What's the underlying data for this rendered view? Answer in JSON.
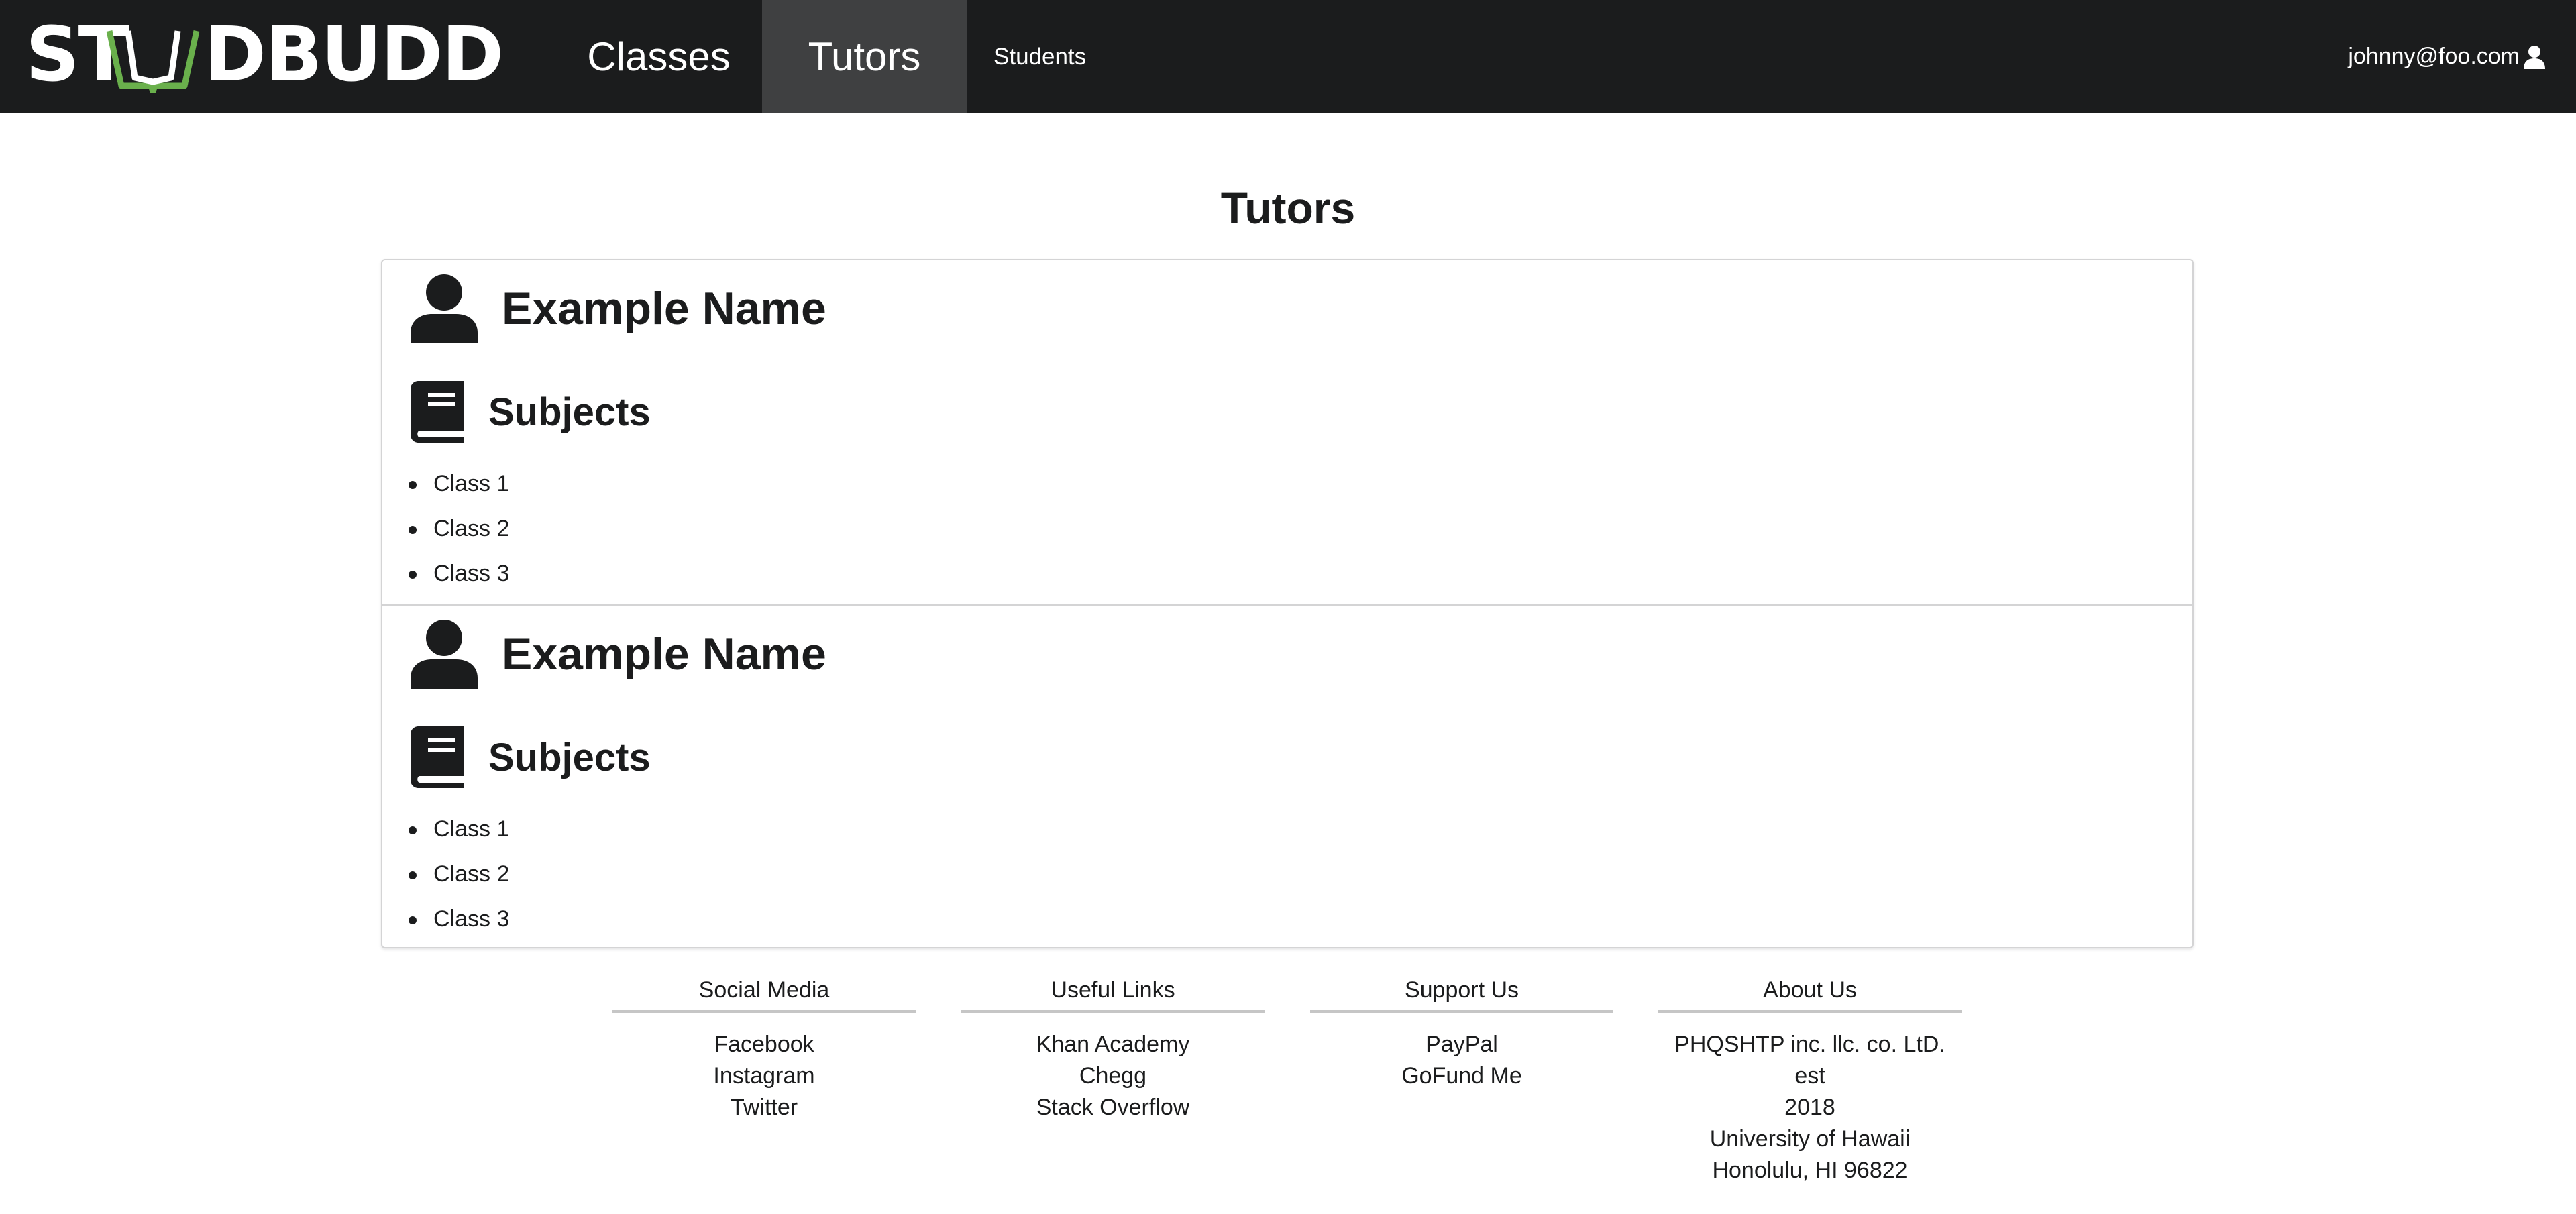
{
  "nav": {
    "logo_text_left": "ST",
    "logo_text_right": "DBUDD",
    "items": [
      {
        "label": "Classes",
        "active": false
      },
      {
        "label": "Tutors",
        "active": true
      },
      {
        "label": "Students",
        "active": false
      }
    ],
    "user_email": "johnny@foo.com",
    "user_icon": "user-icon"
  },
  "colors": {
    "navbar": "#1b1c1d",
    "active_tab": "#3f4041",
    "logo_accent": "#6ab04c"
  },
  "page": {
    "title": "Tutors"
  },
  "tutors": [
    {
      "name": "Example Name",
      "subjects_label": "Subjects",
      "classes": [
        "Class 1",
        "Class 2",
        "Class 3"
      ]
    },
    {
      "name": "Example Name",
      "subjects_label": "Subjects",
      "classes": [
        "Class 1",
        "Class 2",
        "Class 3"
      ]
    }
  ],
  "footer": {
    "social": {
      "heading": "Social Media",
      "links": [
        "Facebook",
        "Instagram",
        "Twitter"
      ]
    },
    "useful": {
      "heading": "Useful Links",
      "links": [
        "Khan Academy",
        "Chegg",
        "Stack Overflow"
      ]
    },
    "support": {
      "heading": "Support Us",
      "links": [
        "PayPal",
        "GoFund Me"
      ]
    },
    "about": {
      "heading": "About Us",
      "lines": [
        "PHQSHTP inc. llc. co. LtD. est",
        "2018",
        "University of Hawaii",
        "Honolulu, HI 96822"
      ]
    }
  }
}
